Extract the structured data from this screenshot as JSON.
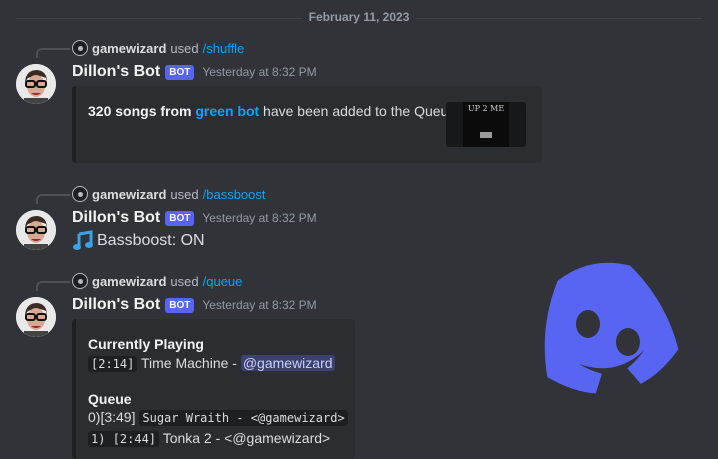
{
  "date_divider": "February 11, 2023",
  "messages": [
    {
      "reply": {
        "user": "gamewizard",
        "used": "used",
        "command": "/shuffle"
      },
      "author": "Dillon's Bot",
      "tag": "BOT",
      "time": "Yesterday at 8:32 PM",
      "embed": {
        "count": "320 songs from",
        "source": "green bot",
        "rest": "have been added to the Queue",
        "thumb_text": "UP 2 ME"
      }
    },
    {
      "reply": {
        "user": "gamewizard",
        "used": "used",
        "command": "/bassboost"
      },
      "author": "Dillon's Bot",
      "tag": "BOT",
      "time": "Yesterday at 8:32 PM",
      "content": "Bassboost: ON",
      "icon": "musical-note-icon"
    },
    {
      "reply": {
        "user": "gamewizard",
        "used": "used",
        "command": "/queue"
      },
      "author": "Dillon's Bot",
      "tag": "BOT",
      "time": "Yesterday at 8:32 PM",
      "embed": {
        "currently_playing_label": "Currently Playing",
        "current": {
          "duration": "[2:14]",
          "title": "Time Machine -",
          "mention": "@gamewizard"
        },
        "queue_label": "Queue",
        "queue": [
          {
            "index": "0)",
            "duration": "[3:49]",
            "text": "Sugar Wraith - <@gamewizard>"
          },
          {
            "index": "1)",
            "duration": "[2:44]",
            "text": "Tonka 2 - <@gamewizard>"
          }
        ]
      }
    }
  ],
  "colors": {
    "background": "#313338",
    "blurple": "#5865f2",
    "link": "#00a8fc"
  }
}
